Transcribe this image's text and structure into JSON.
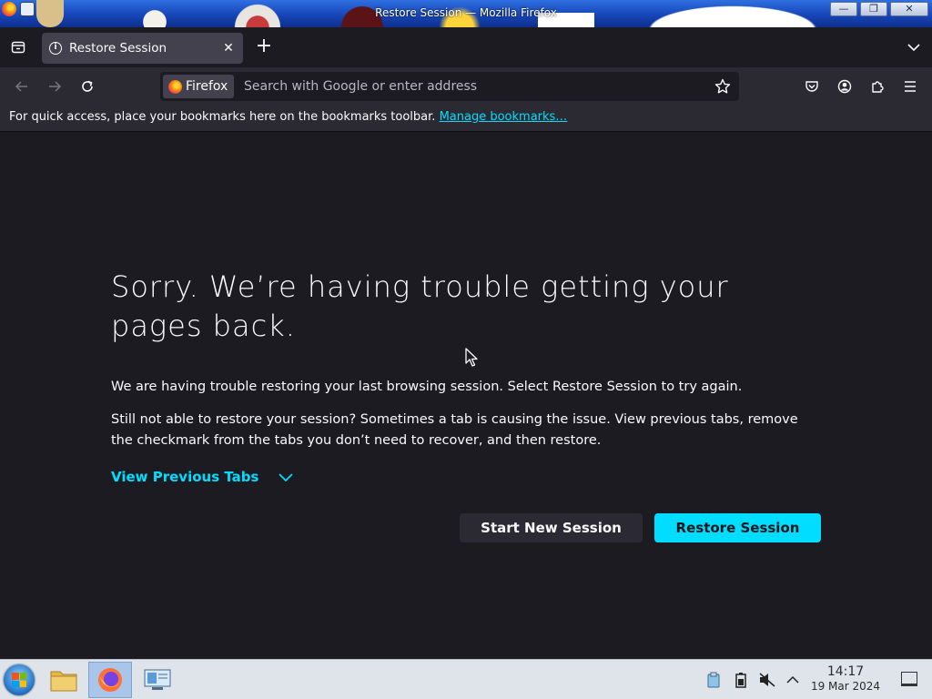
{
  "window": {
    "title": "Restore Session — Mozilla Firefox",
    "buttons": {
      "minimize": "—",
      "maximize": "❐",
      "close": "✕"
    }
  },
  "tabs": [
    {
      "label": "Restore Session",
      "icon": "info-icon",
      "active": true
    }
  ],
  "newtab": "+",
  "urlbar": {
    "identity_label": "Firefox",
    "placeholder": "Search with Google or enter address",
    "value": ""
  },
  "bookmarks_bar": {
    "text": "For quick access, place your bookmarks here on the bookmarks toolbar.",
    "link": "Manage bookmarks…"
  },
  "page": {
    "heading": "Sorry. We’re having trouble getting your pages back.",
    "para1": "We are having trouble restoring your last browsing session. Select Restore Session to try again.",
    "para2": "Still not able to restore your session? Sometimes a tab is causing the issue. View previous tabs, remove the checkmark from the tabs you don’t need to recover, and then restore.",
    "view_previous_tabs": "View Previous Tabs",
    "start_new_session": "Start New Session",
    "restore_session": "Restore Session"
  },
  "taskbar": {
    "apps": [
      "files-icon",
      "firefox-icon",
      "system-settings-icon"
    ],
    "tray": [
      "clipboard-icon",
      "battery-icon",
      "muted-volume-icon",
      "chevron-up-icon"
    ],
    "time": "14:17",
    "date": "19 Mar 2024"
  },
  "colors": {
    "accent": "#00ddff",
    "background": "#1c1b22",
    "toolbar": "#2b2a33"
  }
}
